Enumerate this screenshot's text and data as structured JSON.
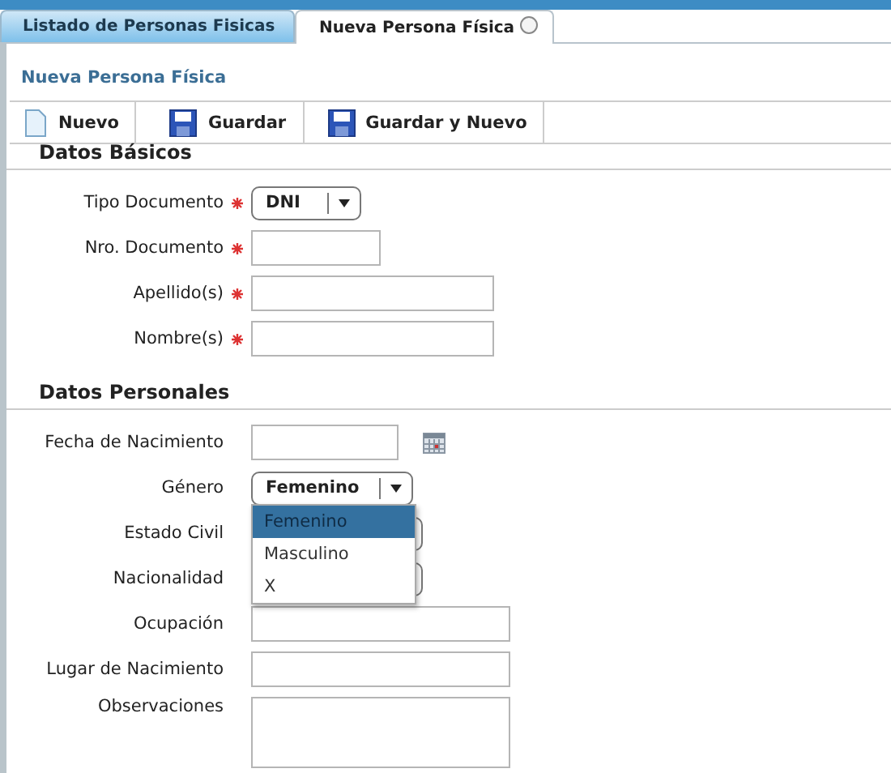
{
  "tabs": [
    {
      "label": "Listado de Personas Fisicas",
      "selected": false,
      "closable": false
    },
    {
      "label": "Nueva Persona Física",
      "selected": true,
      "closable": true
    }
  ],
  "panel_title": "Nueva Persona Física",
  "toolbar": [
    {
      "label": "Nuevo",
      "kind": "new"
    },
    {
      "label": "Guardar",
      "kind": "save"
    },
    {
      "label": "Guardar y Nuevo",
      "kind": "save"
    }
  ],
  "sections": [
    {
      "title": "Datos Básicos",
      "fields": [
        {
          "label": "Tipo Documento",
          "required": true,
          "kind": "select",
          "value": "DNI"
        },
        {
          "label": "Nro. Documento",
          "required": true,
          "kind": "short"
        },
        {
          "label": "Apellido(s)",
          "required": true,
          "kind": "text"
        },
        {
          "label": "Nombre(s)",
          "required": true,
          "kind": "text"
        }
      ]
    },
    {
      "title": "Datos Personales",
      "fields": [
        {
          "label": "Fecha de Nacimiento",
          "required": false,
          "kind": "date"
        },
        {
          "label": "Género",
          "required": false,
          "kind": "select",
          "value": "Femenino",
          "options": [
            {
              "label": "Femenino",
              "selected": true
            },
            {
              "label": "Masculino",
              "selected": false
            },
            {
              "label": "X",
              "selected": false
            }
          ]
        },
        {
          "label": "Estado Civil",
          "required": false,
          "kind": "select"
        },
        {
          "label": "Nacionalidad",
          "required": false,
          "kind": "select"
        },
        {
          "label": "Ocupación",
          "required": false,
          "kind": "wide"
        },
        {
          "label": "Lugar de Nacimiento",
          "required": false,
          "kind": "wide"
        },
        {
          "label": "Observaciones",
          "required": false,
          "kind": "textarea"
        }
      ]
    }
  ]
}
